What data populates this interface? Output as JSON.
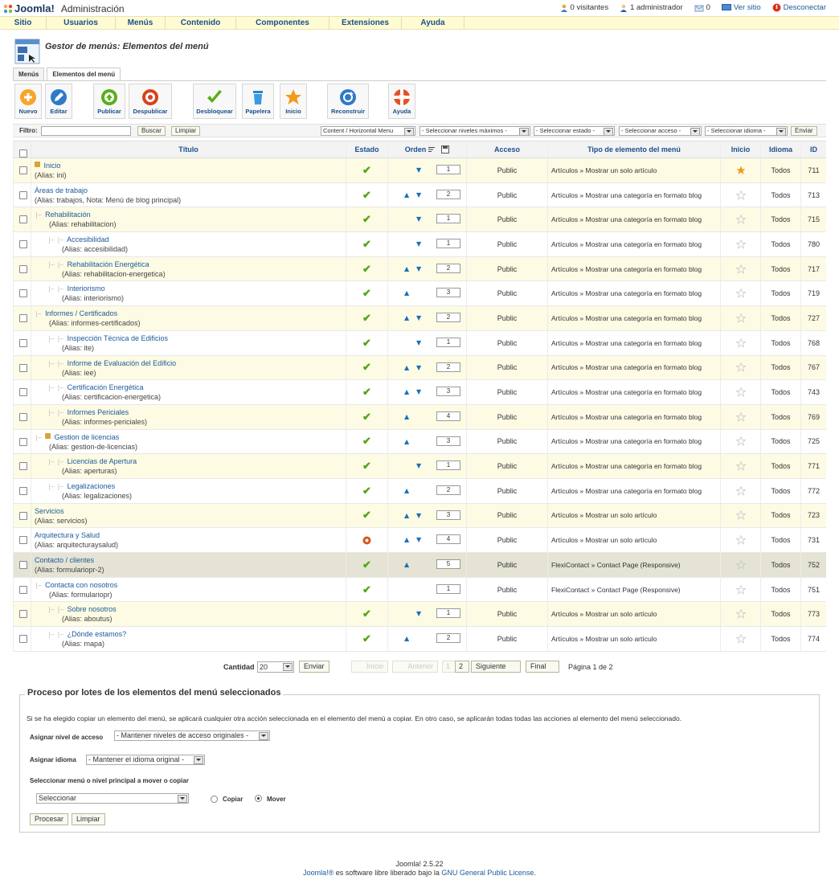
{
  "header": {
    "logo_text": "Joomla!",
    "admin_label": "Administración",
    "status": {
      "visitors": "0 visitantes",
      "admins": "1 administrador",
      "messages": "0",
      "view_site": "Ver sitio",
      "logout": "Desconectar"
    }
  },
  "menu": [
    "Sitio",
    "Usuarios",
    "Menús",
    "Contenido",
    "Componentes",
    "Extensiones",
    "Ayuda"
  ],
  "page_title": "Gestor de menús: Elementos del menú",
  "tabs": [
    "Menús",
    "Elementos del menú"
  ],
  "toolbar": {
    "new": "Nuevo",
    "edit": "Editar",
    "publish": "Publicar",
    "unpublish": "Despublicar",
    "unlock": "Desbloquear",
    "trash": "Papelera",
    "home": "Inicio",
    "rebuild": "Reconstruir",
    "help": "Ayuda"
  },
  "filter": {
    "label": "Filtro:",
    "value": "",
    "search_button": "Buscar",
    "clear_button": "Limpiar",
    "menu_select": "Content / Horizontal Menu",
    "levels_select": "- Seleccionar niveles máximos -",
    "state_select": "- Seleccionar estado -",
    "access_select": "- Seleccionar acceso -",
    "language_select": "- Seleccionar idioma -",
    "submit_button": "Enviar"
  },
  "columns": {
    "title": "Título",
    "state": "Estado",
    "order": "Orden",
    "access": "Acceso",
    "type": "Tipo de elemento del menú",
    "home": "Inicio",
    "language": "Idioma",
    "id": "ID"
  },
  "rows": [
    {
      "title": "Inicio",
      "alias": "(Alias: ini)",
      "level": 0,
      "locked": true,
      "published": true,
      "up": false,
      "down": true,
      "order": "1",
      "access": "Public",
      "type": "Artículos » Mostrar un solo artículo",
      "home": true,
      "lang": "Todos",
      "id": "711"
    },
    {
      "title": "Áreas de trabajo",
      "alias": "(Alias: trabajos, Nota: Menú de blog principal)",
      "level": 0,
      "locked": false,
      "published": true,
      "up": true,
      "down": true,
      "order": "2",
      "access": "Public",
      "type": "Artículos » Mostrar una categoría en formato blog",
      "home": false,
      "lang": "Todos",
      "id": "713"
    },
    {
      "title": "Rehabilitación",
      "alias": "(Alias: rehabilitacion)",
      "level": 1,
      "locked": false,
      "published": true,
      "up": false,
      "down": true,
      "order": "1",
      "access": "Public",
      "type": "Artículos » Mostrar una categoría en formato blog",
      "home": false,
      "lang": "Todos",
      "id": "715"
    },
    {
      "title": "Accesibilidad",
      "alias": "(Alias: accesibilidad)",
      "level": 2,
      "locked": false,
      "published": true,
      "up": false,
      "down": true,
      "order": "1",
      "access": "Public",
      "type": "Artículos » Mostrar una categoría en formato blog",
      "home": false,
      "lang": "Todos",
      "id": "780"
    },
    {
      "title": "Rehabilitación Energética",
      "alias": "(Alias: rehabilitacion-energetica)",
      "level": 2,
      "locked": false,
      "published": true,
      "up": true,
      "down": true,
      "order": "2",
      "access": "Public",
      "type": "Artículos » Mostrar una categoría en formato blog",
      "home": false,
      "lang": "Todos",
      "id": "717"
    },
    {
      "title": "Interiorismo",
      "alias": "(Alias: interiorismo)",
      "level": 2,
      "locked": false,
      "published": true,
      "up": true,
      "down": false,
      "order": "3",
      "access": "Public",
      "type": "Artículos » Mostrar una categoría en formato blog",
      "home": false,
      "lang": "Todos",
      "id": "719"
    },
    {
      "title": "Informes / Certificados",
      "alias": "(Alias: informes-certificados)",
      "level": 1,
      "locked": false,
      "published": true,
      "up": true,
      "down": true,
      "order": "2",
      "access": "Public",
      "type": "Artículos » Mostrar una categoría en formato blog",
      "home": false,
      "lang": "Todos",
      "id": "727"
    },
    {
      "title": "Inspección Técnica de Edificios",
      "alias": "(Alias: ite)",
      "level": 2,
      "locked": false,
      "published": true,
      "up": false,
      "down": true,
      "order": "1",
      "access": "Public",
      "type": "Artículos » Mostrar una categoría en formato blog",
      "home": false,
      "lang": "Todos",
      "id": "768"
    },
    {
      "title": "Informe de Evaluación del Edificio",
      "alias": "(Alias: iee)",
      "level": 2,
      "locked": false,
      "published": true,
      "up": true,
      "down": true,
      "order": "2",
      "access": "Public",
      "type": "Artículos » Mostrar una categoría en formato blog",
      "home": false,
      "lang": "Todos",
      "id": "767"
    },
    {
      "title": "Certificación Energética",
      "alias": "(Alias: certificacion-energetica)",
      "level": 2,
      "locked": false,
      "published": true,
      "up": true,
      "down": true,
      "order": "3",
      "access": "Public",
      "type": "Artículos » Mostrar una categoría en formato blog",
      "home": false,
      "lang": "Todos",
      "id": "743"
    },
    {
      "title": "Informes Periciales",
      "alias": "(Alias: informes-periciales)",
      "level": 2,
      "locked": false,
      "published": true,
      "up": true,
      "down": false,
      "order": "4",
      "access": "Public",
      "type": "Artículos » Mostrar una categoría en formato blog",
      "home": false,
      "lang": "Todos",
      "id": "769"
    },
    {
      "title": "Gestion de licencias",
      "alias": "(Alias: gestion-de-licencias)",
      "level": 1,
      "locked": true,
      "published": true,
      "up": true,
      "down": false,
      "order": "3",
      "access": "Public",
      "type": "Artículos » Mostrar una categoría en formato blog",
      "home": false,
      "lang": "Todos",
      "id": "725"
    },
    {
      "title": "Licencias de Apertura",
      "alias": "(Alias: aperturas)",
      "level": 2,
      "locked": false,
      "published": true,
      "up": false,
      "down": true,
      "order": "1",
      "access": "Public",
      "type": "Artículos » Mostrar una categoría en formato blog",
      "home": false,
      "lang": "Todos",
      "id": "771"
    },
    {
      "title": "Legalizaciones",
      "alias": "(Alias: legalizaciones)",
      "level": 2,
      "locked": false,
      "published": true,
      "up": true,
      "down": false,
      "order": "2",
      "access": "Public",
      "type": "Artículos » Mostrar una categoría en formato blog",
      "home": false,
      "lang": "Todos",
      "id": "772"
    },
    {
      "title": "Servicios",
      "alias": "(Alias: servicios)",
      "level": 0,
      "locked": false,
      "published": true,
      "up": true,
      "down": true,
      "order": "3",
      "access": "Public",
      "type": "Artículos » Mostrar un solo artículo",
      "home": false,
      "lang": "Todos",
      "id": "723"
    },
    {
      "title": "Arquitectura y Salud",
      "alias": "(Alias: arquitecturaysalud)",
      "level": 0,
      "locked": false,
      "published": false,
      "up": true,
      "down": true,
      "order": "4",
      "access": "Public",
      "type": "Artículos » Mostrar un solo artículo",
      "home": false,
      "lang": "Todos",
      "id": "731"
    },
    {
      "title": "Contacto / clientes",
      "alias": "(Alias: formulariopr-2)",
      "level": 0,
      "locked": false,
      "published": true,
      "up": true,
      "down": false,
      "order": "5",
      "access": "Public",
      "type": "FlexiContact » Contact Page (Responsive)",
      "home": false,
      "lang": "Todos",
      "id": "752",
      "highlight": true
    },
    {
      "title": "Contacta con nosotros",
      "alias": "(Alias: formulariopr)",
      "level": 1,
      "locked": false,
      "published": true,
      "up": false,
      "down": false,
      "order": "1",
      "access": "Public",
      "type": "FlexiContact » Contact Page (Responsive)",
      "home": false,
      "lang": "Todos",
      "id": "751"
    },
    {
      "title": "Sobre nosotros",
      "alias": "(Alias: aboutus)",
      "level": 2,
      "locked": false,
      "published": true,
      "up": false,
      "down": true,
      "order": "1",
      "access": "Public",
      "type": "Artículos » Mostrar un solo artículo",
      "home": false,
      "lang": "Todos",
      "id": "773"
    },
    {
      "title": "¿Dónde estamos?",
      "alias": "(Alias: mapa)",
      "level": 2,
      "locked": false,
      "published": true,
      "up": true,
      "down": false,
      "order": "2",
      "access": "Public",
      "type": "Artículos » Mostrar un solo artículo",
      "home": false,
      "lang": "Todos",
      "id": "774"
    }
  ],
  "pagination": {
    "limit_label": "Cantidad",
    "limit_value": "20",
    "submit_button": "Enviar",
    "start": "Inicio",
    "prev": "Anterior",
    "page1": "1",
    "page2": "2",
    "next": "Siguiente",
    "end": "Final",
    "info": "Página 1 de 2"
  },
  "batch": {
    "legend": "Proceso por lotes de los elementos del menú seleccionados",
    "note": "Si se ha elegido copiar un elemento del menú, se aplicará cualquier otra acción seleccionada en el elemento del menú a copiar. En otro caso, se aplicarán todas todas las acciones al elemento del menú seleccionado.",
    "access_label": "Asignar nivel de acceso",
    "access_select": "- Mantener niveles de acceso originales -",
    "language_label": "Asignar idioma",
    "language_select": "- Mantener el idioma original -",
    "move_label": "Seleccionar menú o nivel principal a mover o copiar",
    "move_select": "Seleccionar",
    "copy_label": "Copiar",
    "move_radio_label": "Mover",
    "move_selected": true,
    "process_button": "Procesar",
    "clear_button": "Limpiar"
  },
  "footer": {
    "version": "Joomla! 2.5.22",
    "brand": "Joomla!®",
    "text": " es software libre liberado bajo la ",
    "license": "GNU General Public License",
    "end": "."
  },
  "colors": {
    "menu_bg": "#fffbd2",
    "link": "#1a5a99",
    "published": "#53a516",
    "unpublished": "#d9531e",
    "odd_row": "#fdfbe4"
  }
}
